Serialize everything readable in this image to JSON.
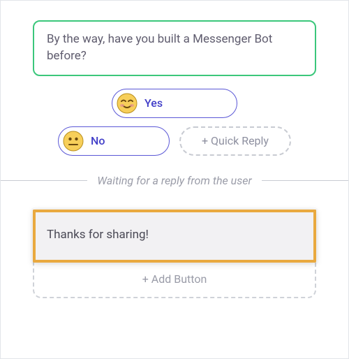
{
  "message": {
    "text": "By the way, have you built a Messenger Bot before?"
  },
  "quick_replies": {
    "items": [
      {
        "label": "Yes",
        "emoji": "blush"
      },
      {
        "label": "No",
        "emoji": "neutral"
      }
    ],
    "add_label": "+ Quick Reply"
  },
  "divider": {
    "label": "Waiting for a reply from the user"
  },
  "response": {
    "text": "Thanks for sharing!",
    "add_button_label": "+ Add Button"
  },
  "colors": {
    "message_border": "#3bc77b",
    "pill_border": "#5a57d6",
    "pill_text": "#413ec8",
    "dashed": "#c8cbd2",
    "highlight": "#e9a93f"
  }
}
